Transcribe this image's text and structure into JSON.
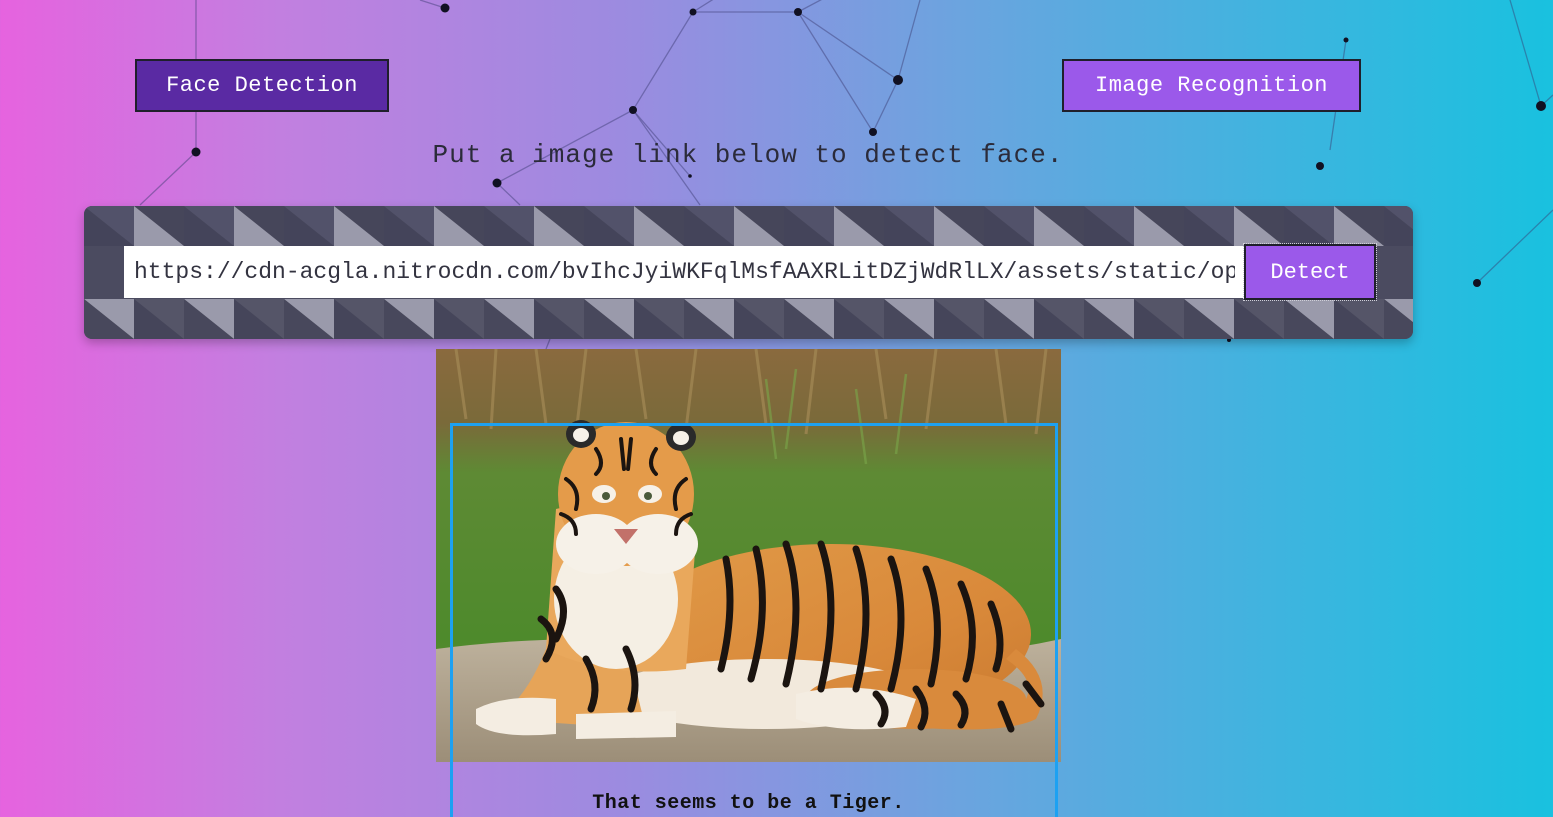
{
  "nav": {
    "face_detection_label": "Face Detection",
    "image_recognition_label": "Image Recognition"
  },
  "instruction": "Put a image link below to detect face.",
  "input": {
    "value": "https://cdn-acgla.nitrocdn.com/bvIhcJyiWKFqlMsfAAXRLitDZjWdRlLX/assets/static/optimized/rev-tiger.jpg",
    "placeholder": ""
  },
  "detect_label": "Detect",
  "result": {
    "text": "That seems to be a Tiger."
  },
  "colors": {
    "gradient_left": "#e663df",
    "gradient_right": "#19c1df",
    "face_button": "#5a2aa3",
    "accent_button": "#9b59ea",
    "panel_dark": "#45455a",
    "panel_light": "#9a9aaa",
    "detection_box": "#1da1f2"
  }
}
